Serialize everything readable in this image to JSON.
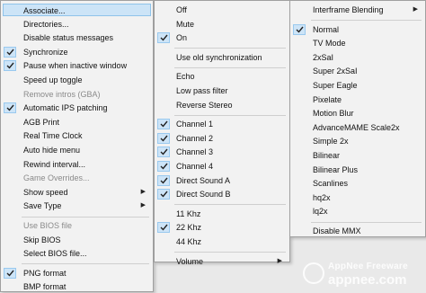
{
  "menus": {
    "main": {
      "items": [
        {
          "label": "Associate...",
          "checked": false,
          "disabled": false,
          "submenu": false,
          "highlighted": true
        },
        {
          "label": "Directories...",
          "checked": false,
          "disabled": false,
          "submenu": false
        },
        {
          "label": "Disable status messages",
          "checked": false,
          "disabled": false,
          "submenu": false
        },
        {
          "label": "Synchronize",
          "checked": true,
          "disabled": false,
          "submenu": false
        },
        {
          "label": "Pause when inactive window",
          "checked": true,
          "disabled": false,
          "submenu": false
        },
        {
          "label": "Speed up toggle",
          "checked": false,
          "disabled": false,
          "submenu": false
        },
        {
          "label": "Remove intros (GBA)",
          "checked": false,
          "disabled": true,
          "submenu": false
        },
        {
          "label": "Automatic IPS patching",
          "checked": true,
          "disabled": false,
          "submenu": false
        },
        {
          "label": "AGB Print",
          "checked": false,
          "disabled": false,
          "submenu": false
        },
        {
          "label": "Real Time Clock",
          "checked": false,
          "disabled": false,
          "submenu": false
        },
        {
          "label": "Auto hide menu",
          "checked": false,
          "disabled": false,
          "submenu": false
        },
        {
          "label": "Rewind interval...",
          "checked": false,
          "disabled": false,
          "submenu": false
        },
        {
          "label": "Game Overrides...",
          "checked": false,
          "disabled": true,
          "submenu": false
        },
        {
          "label": "Show speed",
          "checked": false,
          "disabled": false,
          "submenu": true
        },
        {
          "label": "Save Type",
          "checked": false,
          "disabled": false,
          "submenu": true
        },
        {
          "separator": true
        },
        {
          "label": "Use BIOS file",
          "checked": false,
          "disabled": true,
          "submenu": false
        },
        {
          "label": "Skip BIOS",
          "checked": false,
          "disabled": false,
          "submenu": false
        },
        {
          "label": "Select BIOS file...",
          "checked": false,
          "disabled": false,
          "submenu": false
        },
        {
          "separator": true
        },
        {
          "label": "PNG format",
          "checked": true,
          "disabled": false,
          "submenu": false
        },
        {
          "label": "BMP format",
          "checked": false,
          "disabled": false,
          "submenu": false
        }
      ]
    },
    "sound": {
      "items": [
        {
          "label": "Off",
          "checked": false,
          "disabled": false,
          "submenu": false
        },
        {
          "label": "Mute",
          "checked": false,
          "disabled": false,
          "submenu": false
        },
        {
          "label": "On",
          "checked": true,
          "disabled": false,
          "submenu": false
        },
        {
          "separator": true
        },
        {
          "label": "Use old synchronization",
          "checked": false,
          "disabled": false,
          "submenu": false
        },
        {
          "separator": true
        },
        {
          "label": "Echo",
          "checked": false,
          "disabled": false,
          "submenu": false
        },
        {
          "label": "Low pass filter",
          "checked": false,
          "disabled": false,
          "submenu": false
        },
        {
          "label": "Reverse Stereo",
          "checked": false,
          "disabled": false,
          "submenu": false
        },
        {
          "separator": true
        },
        {
          "label": "Channel 1",
          "checked": true,
          "disabled": false,
          "submenu": false
        },
        {
          "label": "Channel 2",
          "checked": true,
          "disabled": false,
          "submenu": false
        },
        {
          "label": "Channel 3",
          "checked": true,
          "disabled": false,
          "submenu": false
        },
        {
          "label": "Channel 4",
          "checked": true,
          "disabled": false,
          "submenu": false
        },
        {
          "label": "Direct Sound A",
          "checked": true,
          "disabled": false,
          "submenu": false
        },
        {
          "label": "Direct Sound B",
          "checked": true,
          "disabled": false,
          "submenu": false
        },
        {
          "separator": true
        },
        {
          "label": "11 Khz",
          "checked": false,
          "disabled": false,
          "submenu": false
        },
        {
          "label": "22 Khz",
          "checked": true,
          "disabled": false,
          "submenu": false
        },
        {
          "label": "44 Khz",
          "checked": false,
          "disabled": false,
          "submenu": false
        },
        {
          "separator": true
        },
        {
          "label": "Volume",
          "checked": false,
          "disabled": false,
          "submenu": true
        }
      ]
    },
    "filter": {
      "items": [
        {
          "label": "Interframe Blending",
          "checked": false,
          "disabled": false,
          "submenu": true
        },
        {
          "separator": true
        },
        {
          "label": "Normal",
          "checked": true,
          "disabled": false,
          "submenu": false
        },
        {
          "label": "TV Mode",
          "checked": false,
          "disabled": false,
          "submenu": false
        },
        {
          "label": "2xSaI",
          "checked": false,
          "disabled": false,
          "submenu": false
        },
        {
          "label": "Super 2xSaI",
          "checked": false,
          "disabled": false,
          "submenu": false
        },
        {
          "label": "Super Eagle",
          "checked": false,
          "disabled": false,
          "submenu": false
        },
        {
          "label": "Pixelate",
          "checked": false,
          "disabled": false,
          "submenu": false
        },
        {
          "label": "Motion Blur",
          "checked": false,
          "disabled": false,
          "submenu": false
        },
        {
          "label": "AdvanceMAME Scale2x",
          "checked": false,
          "disabled": false,
          "submenu": false
        },
        {
          "label": "Simple 2x",
          "checked": false,
          "disabled": false,
          "submenu": false
        },
        {
          "label": "Bilinear",
          "checked": false,
          "disabled": false,
          "submenu": false
        },
        {
          "label": "Bilinear Plus",
          "checked": false,
          "disabled": false,
          "submenu": false
        },
        {
          "label": "Scanlines",
          "checked": false,
          "disabled": false,
          "submenu": false
        },
        {
          "label": "hq2x",
          "checked": false,
          "disabled": false,
          "submenu": false
        },
        {
          "label": "lq2x",
          "checked": false,
          "disabled": false,
          "submenu": false
        },
        {
          "separator": true
        },
        {
          "label": "Disable MMX",
          "checked": false,
          "disabled": false,
          "submenu": false
        }
      ]
    }
  },
  "watermark": {
    "line1": "AppNee Freeware",
    "line2": "appnee.com"
  },
  "colors": {
    "menu_bg": "#f2f2f2",
    "highlight": "#cce4f7",
    "check_bg": "#cde4f7",
    "disabled_text": "#8a8a8a"
  }
}
